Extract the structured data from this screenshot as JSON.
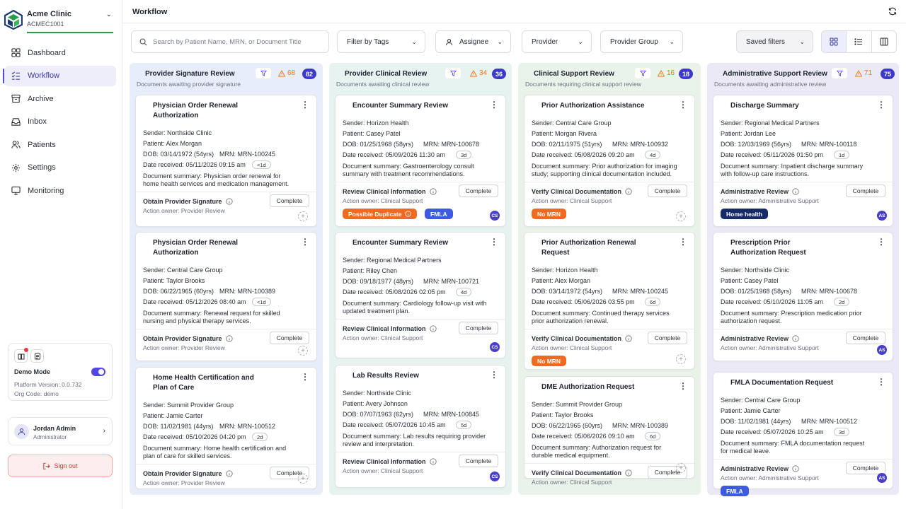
{
  "org": {
    "name": "Acme Clinic",
    "code": "ACMEC1001"
  },
  "nav": [
    {
      "label": "Dashboard",
      "icon": "dashboard-icon"
    },
    {
      "label": "Workflow",
      "icon": "workflow-icon"
    },
    {
      "label": "Archive",
      "icon": "archive-icon"
    },
    {
      "label": "Inbox",
      "icon": "inbox-icon"
    },
    {
      "label": "Patients",
      "icon": "patients-icon"
    },
    {
      "label": "Settings",
      "icon": "settings-icon"
    },
    {
      "label": "Monitoring",
      "icon": "monitor-icon"
    }
  ],
  "demo": {
    "label": "Demo Mode",
    "platform": "Platform Version: 0.0.732",
    "org_code": "Org Code: demo"
  },
  "user": {
    "name": "Jordan Admin",
    "role": "Administrator"
  },
  "signout": "Sign out",
  "header": {
    "title": "Workflow"
  },
  "toolbar": {
    "search_placeholder": "Search by Patient Name, MRN, or Document Title",
    "filter_tags": "Filter by Tags",
    "assignee": "Assignee",
    "provider": "Provider",
    "provider_group": "Provider Group",
    "saved_filters": "Saved filters"
  },
  "colors": {
    "accent": "#4f46e5",
    "green": "#2a9d48",
    "orange": "#f26a21"
  },
  "columns": [
    {
      "title": "Provider Signature Review",
      "subtitle": "Documents awaiting provider signature",
      "warn": "68",
      "count": "82",
      "cards": [
        {
          "title": "Physician Order Renewal Authorization",
          "sender": "Sender: Northside Clinic",
          "patient": "Patient: Alex Morgan",
          "dob": "DOB: 03/14/1972 (54yrs)",
          "mrn": "MRN: MRN-100245",
          "date": "Date received:   05/11/2026 09:15 am",
          "age": "<1d",
          "summary": "Document summary: Physician order renewal for home health services and medication management.",
          "action": "Obtain Provider Signature",
          "owner": "Action owner:  Provider Review",
          "button": "Complete",
          "tags": [],
          "initials": ""
        },
        {
          "title": "Physician Order Renewal Authorization",
          "sender": "Sender: Central Care Group",
          "patient": "Patient: Taylor Brooks",
          "dob": "DOB: 06/22/1965 (60yrs)",
          "mrn": "MRN: MRN-100389",
          "date": "Date received:   05/12/2026 08:40 am",
          "age": "<1d",
          "summary": "Document summary: Renewal request for skilled nursing and physical therapy services.",
          "action": "Obtain Provider Signature",
          "owner": "Action owner:  Provider Review",
          "button": "Complete",
          "tags": [],
          "initials": ""
        },
        {
          "title": "Home Health Certification and Plan of Care",
          "sender": "Sender: Summit Provider Group",
          "patient": "Patient: Jamie Carter",
          "dob": "DOB: 11/02/1981 (44yrs)",
          "mrn": "MRN: MRN-100512",
          "date": "Date received:   05/10/2026 04:20 pm",
          "age": "2d",
          "summary": "Document summary: Home health certification and plan of care for skilled services.",
          "action": "Obtain Provider Signature",
          "owner": "Action owner:  Provider Review",
          "button": "Complete",
          "tags": [],
          "initials": ""
        }
      ]
    },
    {
      "title": "Provider Clinical Review",
      "subtitle": "Documents awaiting clinical review",
      "warn": "34",
      "count": "36",
      "cards": [
        {
          "title": "Encounter Summary Review",
          "sender": "Sender: Horizon Health",
          "patient": "Patient: Casey Patel",
          "dob": "DOB: 01/25/1968 (58yrs)",
          "mrn": "MRN: MRN-100678",
          "date": "Date received:   05/09/2026 11:30 am",
          "age": "3d",
          "summary": "Document summary: Gastroenterology consult summary with treatment recommendations.",
          "action": "Review Clinical Information",
          "owner": "Action owner:  Clinical Support",
          "button": "Complete",
          "tags": [
            {
              "label": "Possible Duplicate",
              "color": "orange"
            },
            {
              "label": "FMLA",
              "color": "blue"
            }
          ],
          "initials": "CS"
        },
        {
          "title": "Encounter Summary Review",
          "sender": "Sender: Regional Medical Partners",
          "patient": "Patient: Riley Chen",
          "dob": "DOB: 09/18/1977 (48yrs)",
          "mrn": "MRN: MRN-100721",
          "date": "Date received:   05/08/2026 02:05 pm",
          "age": "4d",
          "summary": "Document summary: Cardiology follow-up visit with updated treatment plan.",
          "action": "Review Clinical Information",
          "owner": "Action owner:  Clinical Support",
          "button": "Complete",
          "tags": [],
          "initials": "CS"
        },
        {
          "title": "Lab Results Review",
          "sender": "Sender: Northside Clinic",
          "patient": "Patient: Avery Johnson",
          "dob": "DOB: 07/07/1963 (62yrs)",
          "mrn": "MRN: MRN-100845",
          "date": "Date received:   05/07/2026 10:45 am",
          "age": "5d",
          "summary": "Document summary: Lab results requiring provider review and interpretation.",
          "action": "Review Clinical Information",
          "owner": "Action owner:  Clinical Support",
          "button": "Complete",
          "tags": [],
          "initials": "CS"
        }
      ]
    },
    {
      "title": "Clinical Support Review",
      "subtitle": "Documents requiring clinical support review",
      "warn": "16",
      "count": "18",
      "cards": [
        {
          "title": "Prior Authorization Assistance",
          "sender": "Sender: Central Care Group",
          "patient": "Patient: Morgan Rivera",
          "dob": "DOB: 02/11/1975 (51yrs)",
          "mrn": "MRN: MRN-100932",
          "date": "Date received:   05/08/2026 09:20 am",
          "age": "4d",
          "summary": "Document summary: Prior authorization for imaging study; supporting clinical documentation included.",
          "action": "Verify Clinical Documentation",
          "owner": "Action owner:  Clinical Support",
          "button": "Complete",
          "tags": [
            {
              "label": "No MRN",
              "color": "orange"
            }
          ],
          "initials": ""
        },
        {
          "title": "Prior Authorization Renewal Request",
          "sender": "Sender: Horizon Health",
          "patient": "Patient: Alex Morgan",
          "dob": "DOB: 03/14/1972 (54yrs)",
          "mrn": "MRN: MRN-100245",
          "date": "Date received:   05/06/2026 03:55 pm",
          "age": "6d",
          "summary": "Document summary: Continued therapy services prior authorization renewal.",
          "action": "Verify Clinical Documentation",
          "owner": "Action owner:  Clinical Support",
          "button": "Complete",
          "tags": [
            {
              "label": "No MRN",
              "color": "orange"
            }
          ],
          "initials": ""
        },
        {
          "title": "DME Authorization Request",
          "sender": "Sender: Summit Provider Group",
          "patient": "Patient: Taylor Brooks",
          "dob": "DOB: 06/22/1965 (60yrs)",
          "mrn": "MRN: MRN-100389",
          "date": "Date received:   05/06/2026 09:10 am",
          "age": "6d",
          "summary": "Document summary: Authorization request for durable medical equipment.",
          "action": "Verify Clinical Documentation",
          "owner": "Action owner:  Clinical Support",
          "button": "Complete",
          "tags": [],
          "initials": ""
        }
      ]
    },
    {
      "title": "Administrative Support Review",
      "subtitle": "Documents awaiting administrative review",
      "warn": "71",
      "count": "75",
      "cards": [
        {
          "title": "Discharge Summary",
          "sender": "Sender: Regional Medical Partners",
          "patient": "Patient: Jordan Lee",
          "dob": "DOB: 12/03/1969 (56yrs)",
          "mrn": "MRN: MRN-100118",
          "date": "Date received:   05/11/2026 01:50 pm",
          "age": "1d",
          "summary": "Document summary: Inpatient discharge summary with follow-up care instructions.",
          "action": "Administrative Review",
          "owner": "Action owner:  Administrative Support",
          "button": "Complete",
          "tags": [
            {
              "label": "Home health",
              "color": "navy"
            }
          ],
          "initials": "AS"
        },
        {
          "title": "Prescription Prior Authorization Request",
          "sender": "Sender: Northside Clinic",
          "patient": "Patient: Casey Patel",
          "dob": "DOB: 01/25/1968 (58yrs)",
          "mrn": "MRN: MRN-100678",
          "date": "Date received:   05/10/2026 11:05 am",
          "age": "2d",
          "summary": "Document summary: Prescription medication prior authorization request.",
          "action": "Administrative Review",
          "owner": "Action owner:  Administrative Support",
          "button": "Complete",
          "tags": [],
          "initials": "AS"
        },
        {
          "title": "FMLA Documentation Request",
          "sender": "Sender: Central Care Group",
          "patient": "Patient: Jamie Carter",
          "dob": "DOB: 11/02/1981 (44yrs)",
          "mrn": "MRN: MRN-100512",
          "date": "Date received:   05/07/2026 10:25 am",
          "age": "3d",
          "summary": "Document summary: FMLA documentation request for medical leave.",
          "action": "Administrative Review",
          "owner": "Action owner:  Administrative Support",
          "button": "Complete",
          "tags": [
            {
              "label": "FMLA",
              "color": "blue"
            }
          ],
          "initials": "AS"
        }
      ]
    }
  ]
}
